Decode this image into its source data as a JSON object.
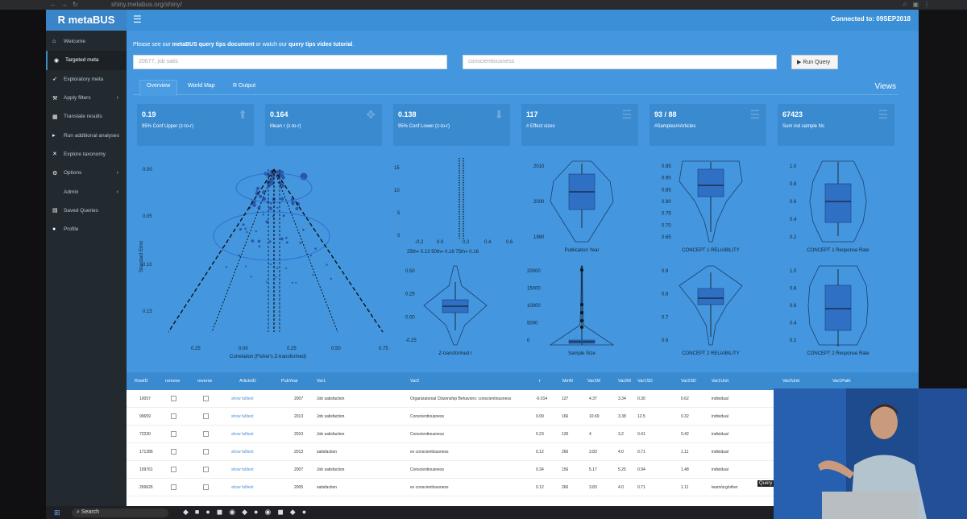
{
  "app": {
    "title": "R metaBUS",
    "connected": "Connected to: 09SEP2018"
  },
  "browser": {
    "url": "shiny.metabus.org/shiny/"
  },
  "sidebar": {
    "items": [
      {
        "label": "Welcome",
        "icon": "home-icon"
      },
      {
        "label": "Targeted meta",
        "icon": "crosshair-icon"
      },
      {
        "label": "Exploratory meta",
        "icon": "rocket-icon"
      },
      {
        "label": "Apply filters",
        "icon": "filter-icon"
      },
      {
        "label": "Translate results",
        "icon": "translate-icon"
      },
      {
        "label": "Run additional analyses",
        "icon": "run-icon"
      },
      {
        "label": "Explore taxonomy",
        "icon": "taxonomy-icon"
      },
      {
        "label": "Options",
        "icon": "options-icon"
      },
      {
        "label": "Admin",
        "icon": ""
      },
      {
        "label": "Saved Queries",
        "icon": "bookmark-icon"
      },
      {
        "label": "Profile",
        "icon": "user-icon"
      }
    ]
  },
  "info": {
    "prefix": "Please see our",
    "link1": "metaBUS query tips document",
    "middle": "or watch our",
    "link2": "query tips video tutorial",
    "suffix": "."
  },
  "query": {
    "input1": "20677, job satis",
    "input2": "conscientiousness",
    "run_label": "Run Query"
  },
  "tabs": [
    "Overview",
    "World Map",
    "R Output"
  ],
  "views_label": "Views",
  "stats": [
    {
      "value": "0.19",
      "label": "95% Conf Upper (z-to-r)",
      "icon": "arrow-up-icon"
    },
    {
      "value": "0.164",
      "label": "Mean r (z-to-r)",
      "icon": "move-icon"
    },
    {
      "value": "0.138",
      "label": "95% Conf Lower (z-to-r)",
      "icon": "arrow-down-icon"
    },
    {
      "value": "117",
      "label": "# Effect sizes",
      "icon": "list-icon"
    },
    {
      "value": "93 / 88",
      "label": "#Samples/#Articles",
      "icon": "list-icon"
    },
    {
      "value": "67423",
      "label": "Sum ind sample Ns",
      "icon": "list-icon"
    }
  ],
  "funnel": {
    "xlabel": "Correlation (Fisher's Z-transformed)",
    "ylabel": "Standard Error",
    "yticks": [
      "0.00",
      "0.05",
      "0.10",
      "0.15"
    ],
    "xticks": [
      "0.25",
      "0.00",
      "0.25",
      "0.50",
      "0.75"
    ]
  },
  "quantile_plot": {
    "yticks": [
      "15",
      "10",
      "5",
      "0"
    ],
    "xticks": [
      "-0.2",
      "0.0",
      "0.2",
      "0.4",
      "0.6"
    ],
    "caption": "25th= 0.13 50th= 0.16 75th= 0.16"
  },
  "violins": [
    {
      "label": "Publication Year",
      "ticks": [
        "2010",
        "2000",
        "1990"
      ]
    },
    {
      "label": "CONCEPT 1 RELIABILITY",
      "ticks": [
        "0.95",
        "0.90",
        "0.85",
        "0.80",
        "0.75",
        "0.70",
        "0.65"
      ]
    },
    {
      "label": "CONCEPT 1 Response Rate",
      "ticks": [
        "1.0",
        "0.8",
        "0.6",
        "0.4",
        "0.2"
      ]
    },
    {
      "label": "Z-transformed r",
      "ticks": [
        "0.50",
        "0.25",
        "0.00",
        "-0.25"
      ]
    },
    {
      "label": "Sample Size",
      "ticks": [
        "20000",
        "15000",
        "10000",
        "5000",
        "0"
      ]
    },
    {
      "label": "CONCEPT 2 RELIABILITY",
      "ticks": [
        "0.9",
        "0.8",
        "0.7",
        "0.6"
      ]
    },
    {
      "label": "CONCEPT 2 Response Rate",
      "ticks": [
        "1.0",
        "0.8",
        "0.6",
        "0.4",
        "0.2"
      ]
    }
  ],
  "table": {
    "headers": [
      "RowID",
      "remove",
      "reverse",
      "ArticleID",
      "PubYear",
      "Var1",
      "Var2",
      "r",
      "MinN",
      "Var1M",
      "Var2M",
      "Var1SD",
      "Var2SD",
      "Var1Unit",
      "Var2Unit",
      "Var1Path"
    ],
    "rows": [
      [
        "10057",
        "",
        "",
        "show fulltext",
        "2007",
        "Job satisfaction",
        "Organizational Citizenship Behaviors: conscientiousness",
        "-0.014",
        "127",
        "4.37",
        "3.34",
        "0.30",
        "0.62",
        "individual"
      ],
      [
        "99659",
        "",
        "",
        "show fulltext",
        "2013",
        "Job satisfaction",
        "Conscientiousness",
        "0.09",
        "166",
        "10.69",
        "3.38",
        "12.5",
        "0.32",
        "individual"
      ],
      [
        "72230",
        "",
        "",
        "show fulltext",
        "2010",
        "Job satisfaction",
        "Conscientiousness",
        "0.23",
        "130",
        "4",
        "3.2",
        "0.41",
        "0.42",
        "individual"
      ],
      [
        "171286",
        "",
        "",
        "show fulltext",
        "2013",
        "satisfaction",
        "ex conscientiousness",
        "0.12",
        "266",
        "3.83",
        "4.0",
        "0.71",
        "1.11",
        "individual"
      ],
      [
        "109761",
        "",
        "",
        "show fulltext",
        "2007",
        "Job satisfaction",
        "Conscientiousness",
        "0.34",
        "156",
        "5.17",
        "5.25",
        "0.94",
        "1.48",
        "individual"
      ],
      [
        "269626",
        "",
        "",
        "show fulltext",
        "2005",
        "satisfaction",
        "ex conscientiousness",
        "0.12",
        "266",
        "3.83",
        "4.0",
        "0.71",
        "1.11",
        "team/org/other"
      ]
    ]
  },
  "tooltip": "Query",
  "taskbar": {
    "search": "Search"
  },
  "colors": {
    "accent": "#3c8dbc",
    "main_bg": "#4497de",
    "sidebar_bg": "#222a30",
    "box_fill": "#2f6fc4"
  }
}
